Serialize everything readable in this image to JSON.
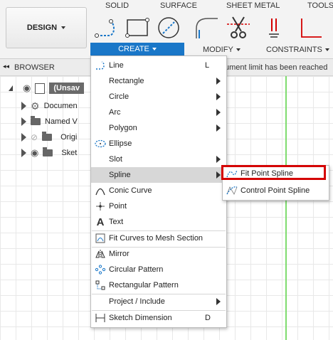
{
  "toolbar": {
    "workspace_label": "DESIGN",
    "tabs": [
      "SOLID",
      "SURFACE",
      "SHEET METAL",
      "TOOLS"
    ],
    "groups": {
      "create": "CREATE",
      "modify": "MODIFY",
      "constraints": "CONSTRAINTS"
    }
  },
  "browser": {
    "title": "BROWSER",
    "notice": "ument limit has been reached",
    "root": "(Unsav",
    "items": [
      "Documen",
      "Named V",
      "Origi",
      "Sket"
    ]
  },
  "menu": {
    "items": [
      {
        "label": "Line",
        "shortcut": "L"
      },
      {
        "label": "Rectangle"
      },
      {
        "label": "Circle"
      },
      {
        "label": "Arc"
      },
      {
        "label": "Polygon"
      },
      {
        "label": "Ellipse"
      },
      {
        "label": "Slot"
      },
      {
        "label": "Spline"
      },
      {
        "label": "Conic Curve"
      },
      {
        "label": "Point"
      },
      {
        "label": "Text"
      },
      {
        "label": "Fit Curves to Mesh Section"
      },
      {
        "label": "Mirror"
      },
      {
        "label": "Circular Pattern"
      },
      {
        "label": "Rectangular Pattern"
      },
      {
        "label": "Project / Include"
      },
      {
        "label": "Sketch Dimension",
        "shortcut": "D"
      }
    ]
  },
  "submenu": {
    "items": [
      "Fit Point Spline",
      "Control Point Spline"
    ]
  },
  "colors": {
    "accent": "#1a77c8",
    "highlight_border": "#d40000",
    "axis": "#7fdc6f"
  }
}
